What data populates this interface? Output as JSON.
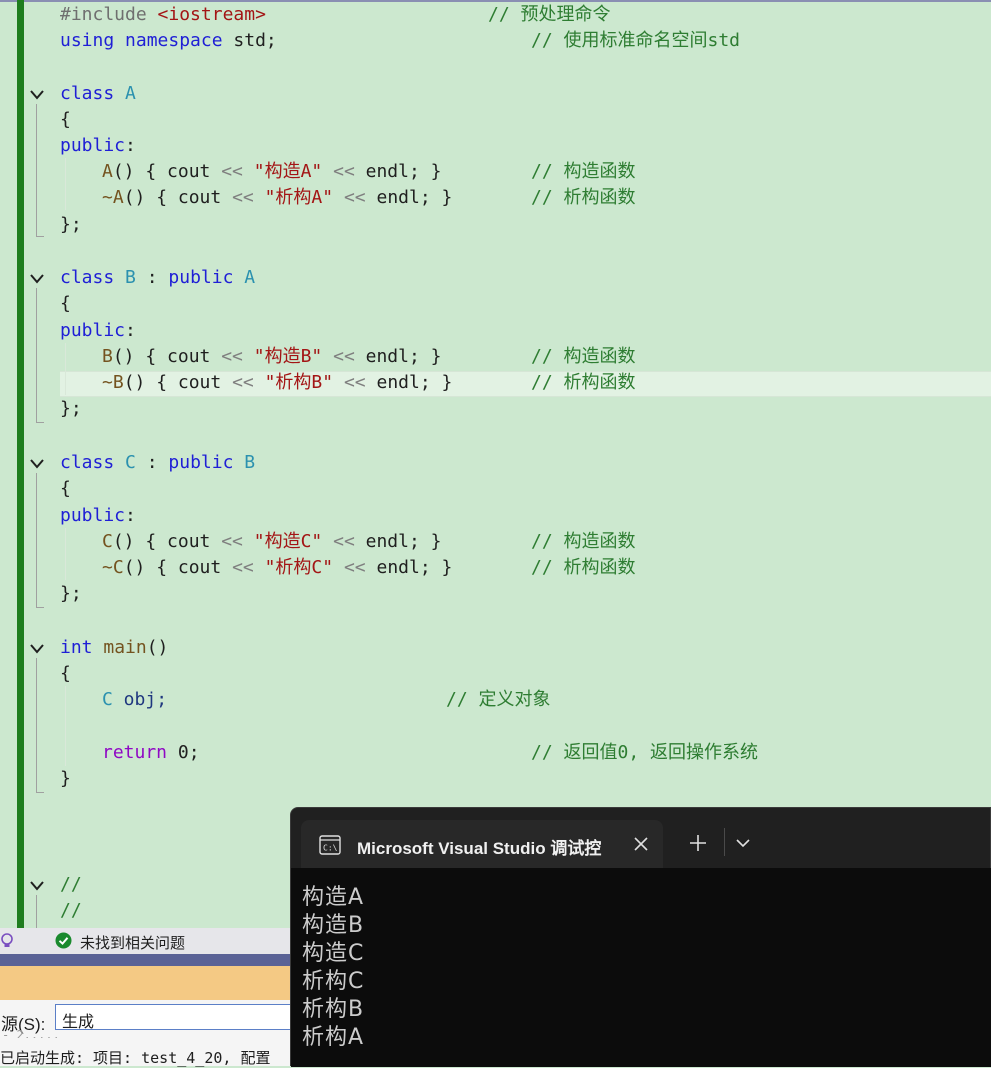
{
  "editor": {
    "lines": {
      "l1": {
        "include": "#include ",
        "header": "<iostream>",
        "comment": "// 预处理命令"
      },
      "l2": {
        "kw1": "using",
        "kw2": "namespace",
        "rest": " std;",
        "comment": "// 使用标准命名空间std"
      },
      "classA": {
        "kw": "class",
        "name": "A"
      },
      "brace_open": "{",
      "brace_close": "};",
      "public": "public",
      "colon": ":",
      "ctorA": {
        "name": "A",
        "body_pre": "() { cout ",
        "op1": "<<",
        "str": "\"构造A\"",
        "op2": "<<",
        "tail": " endl; }",
        "comment": "// 构造函数"
      },
      "dtorA": {
        "name": "~A",
        "body_pre": "() { cout ",
        "op1": "<<",
        "str": "\"析构A\"",
        "op2": "<<",
        "tail": " endl; }",
        "comment": "// 析构函数"
      },
      "classB": {
        "kw": "class",
        "name": "B",
        "colon": " : ",
        "kw2": "public",
        "base": "A"
      },
      "ctorB": {
        "name": "B",
        "body_pre": "() { cout ",
        "op1": "<<",
        "str": "\"构造B\"",
        "op2": "<<",
        "tail": " endl; }",
        "comment": "// 构造函数"
      },
      "dtorB": {
        "name": "~B",
        "body_pre": "() { cout ",
        "op1": "<<",
        "str": "\"析构B\"",
        "op2": "<<",
        "tail": " endl; }",
        "comment": "// 析构函数"
      },
      "classC": {
        "kw": "class",
        "name": "C",
        "colon": " : ",
        "kw2": "public",
        "base": "B"
      },
      "ctorC": {
        "name": "C",
        "body_pre": "() { cout ",
        "op1": "<<",
        "str": "\"构造C\"",
        "op2": "<<",
        "tail": " endl; }",
        "comment": "// 构造函数"
      },
      "dtorC": {
        "name": "~C",
        "body_pre": "() { cout ",
        "op1": "<<",
        "str": "\"析构C\"",
        "op2": "<<",
        "tail": " endl; }",
        "comment": "// 析构函数"
      },
      "main": {
        "kw": "int",
        "name": "main",
        "parens": "()"
      },
      "main_open": "{",
      "obj": {
        "type": "C",
        "var": " obj;",
        "comment": "// 定义对象"
      },
      "ret": {
        "kw": "return",
        "rest": " 0;",
        "comment": "// 返回值0, 返回操作系统"
      },
      "main_close": "}",
      "c1": "//",
      "c2": "//"
    }
  },
  "status": {
    "text": "未找到相关问题"
  },
  "output": {
    "source_label": "源(S):",
    "source_value": "生成",
    "faded_line": "- 2.....",
    "log_line": "已启动生成: 项目: test_4_20, 配置"
  },
  "terminal": {
    "tab_title": "Microsoft Visual Studio 调试控",
    "lines": [
      "构造A",
      "构造B",
      "构造C",
      "析构C",
      "析构B",
      "析构A"
    ]
  }
}
